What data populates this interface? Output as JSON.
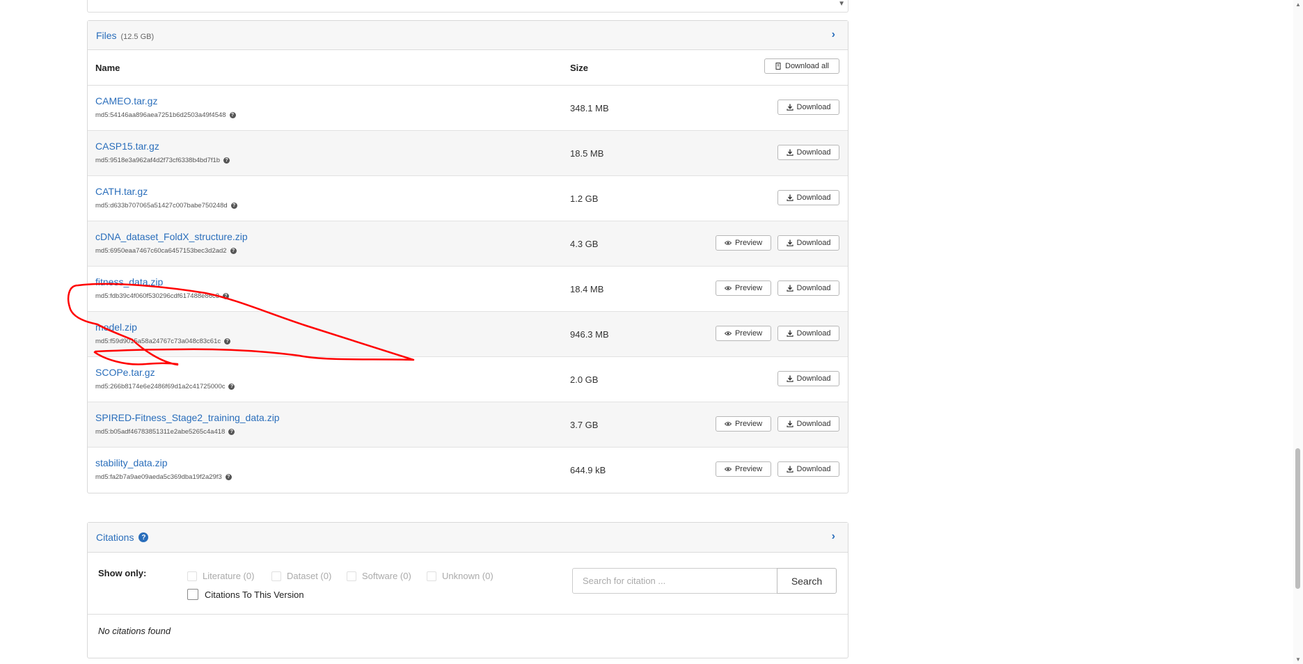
{
  "files": {
    "title": "Files",
    "total_size": "(12.5 GB)",
    "col_name": "Name",
    "col_size": "Size",
    "download_all_label": "Download all",
    "download_label": "Download",
    "preview_label": "Preview",
    "rows": [
      {
        "name": "CAMEO.tar.gz",
        "md5": "md5:54146aa896aea7251b6d2503a49f4548",
        "size": "348.1 MB",
        "preview": false
      },
      {
        "name": "CASP15.tar.gz",
        "md5": "md5:9518e3a962af4d2f73cf6338b4bd7f1b",
        "size": "18.5 MB",
        "preview": false
      },
      {
        "name": "CATH.tar.gz",
        "md5": "md5:d633b707065a51427c007babe750248d",
        "size": "1.2 GB",
        "preview": false
      },
      {
        "name": "cDNA_dataset_FoldX_structure.zip",
        "md5": "md5:6950eaa7467c60ca6457153bec3d2ad2",
        "size": "4.3 GB",
        "preview": true
      },
      {
        "name": "fitness_data.zip",
        "md5": "md5:fdb39c4f060f530296cdf617488e86c3",
        "size": "18.4 MB",
        "preview": true
      },
      {
        "name": "model.zip",
        "md5": "md5:f59d9015a58a24767c73a048c83c61c",
        "size": "946.3 MB",
        "preview": true
      },
      {
        "name": "SCOPe.tar.gz",
        "md5": "md5:266b8174e6e2486f69d1a2c41725000c",
        "size": "2.0 GB",
        "preview": false
      },
      {
        "name": "SPIRED-Fitness_Stage2_training_data.zip",
        "md5": "md5:b05adf46783851311e2abe5265c4a418",
        "size": "3.7 GB",
        "preview": true
      },
      {
        "name": "stability_data.zip",
        "md5": "md5:fa2b7a9ae09aeda5c369dba19f2a29f3",
        "size": "644.9 kB",
        "preview": true
      }
    ]
  },
  "citations": {
    "title": "Citations",
    "show_only_label": "Show only:",
    "filters": [
      "Literature (0)",
      "Dataset (0)",
      "Software (0)",
      "Unknown (0)"
    ],
    "citations_to_version_label": "Citations To This Version",
    "search_placeholder": "Search for citation ...",
    "search_button_label": "Search",
    "empty_message": "No citations found"
  },
  "annotation": {
    "color": "#ff0000"
  }
}
